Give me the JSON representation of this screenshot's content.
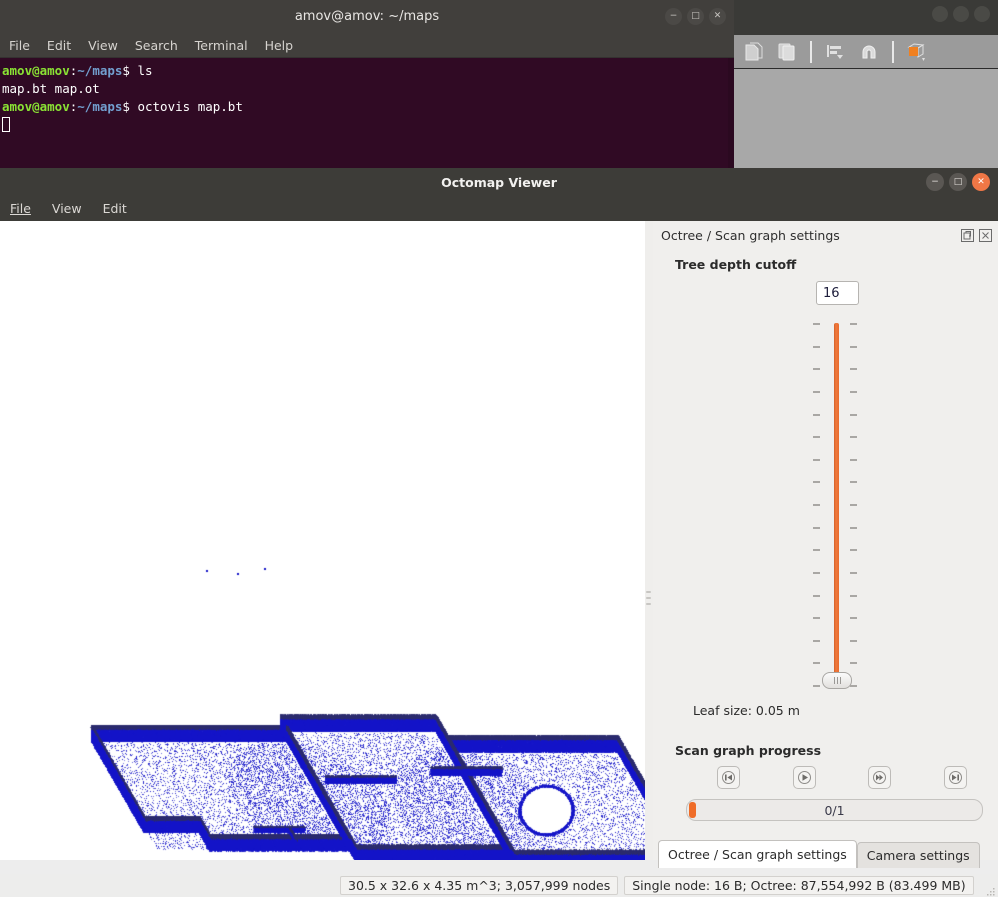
{
  "background_app": {
    "toolbar_icons": [
      "new-document-icon",
      "paste-icon",
      "separator",
      "align-icon",
      "magnet-icon",
      "separator",
      "cube-color-icon"
    ],
    "window_buttons": [
      "minimize",
      "maximize",
      "close"
    ]
  },
  "terminal": {
    "title": "amov@amov: ~/maps",
    "menu": [
      "File",
      "Edit",
      "View",
      "Search",
      "Terminal",
      "Help"
    ],
    "window_buttons": [
      "−",
      "□",
      "✕"
    ],
    "lines": [
      {
        "prompt_user": "amov@amov",
        "prompt_colon": ":",
        "prompt_path": "~/maps",
        "prompt_sym": "$ ",
        "command": "ls"
      },
      {
        "output": "map.bt   map.ot"
      },
      {
        "prompt_user": "amov@amov",
        "prompt_colon": ":",
        "prompt_path": "~/maps",
        "prompt_sym": "$ ",
        "command": "octovis map.bt"
      }
    ],
    "colors": {
      "background": "#300a24",
      "user": "#8ae234",
      "path": "#729fcf",
      "text": "#ffffff"
    }
  },
  "viewer": {
    "title": "Octomap Viewer",
    "menu": [
      "File",
      "View",
      "Edit"
    ],
    "window_buttons": [
      "−",
      "□",
      "✕"
    ],
    "viewport": {
      "background": "#ffffff",
      "point_color": "#1414c8"
    }
  },
  "dock": {
    "header_title": "Octree / Scan graph settings",
    "header_buttons": [
      "float-icon",
      "close-icon"
    ],
    "tree_depth": {
      "label": "Tree depth cutoff",
      "value": "16",
      "slider_color": "#ef6c28",
      "tick_count": 17
    },
    "leaf_size": "Leaf size:  0.05 m",
    "scan_graph": {
      "label": "Scan graph progress",
      "buttons": [
        "skip-back-icon",
        "play-icon",
        "step-forward-icon",
        "skip-end-icon"
      ],
      "progress_text": "0/1",
      "progress_percent": 2
    },
    "tabs": [
      {
        "label": "Octree / Scan graph settings",
        "active": true
      },
      {
        "label": "Camera settings",
        "active": false
      }
    ]
  },
  "statusbar": {
    "dimensions": "30.5 x 32.6 x 4.35 m^3; 3,057,999 nodes",
    "memory": "Single node: 16 B; Octree: 87,554,992 B (83.499 MB)"
  }
}
